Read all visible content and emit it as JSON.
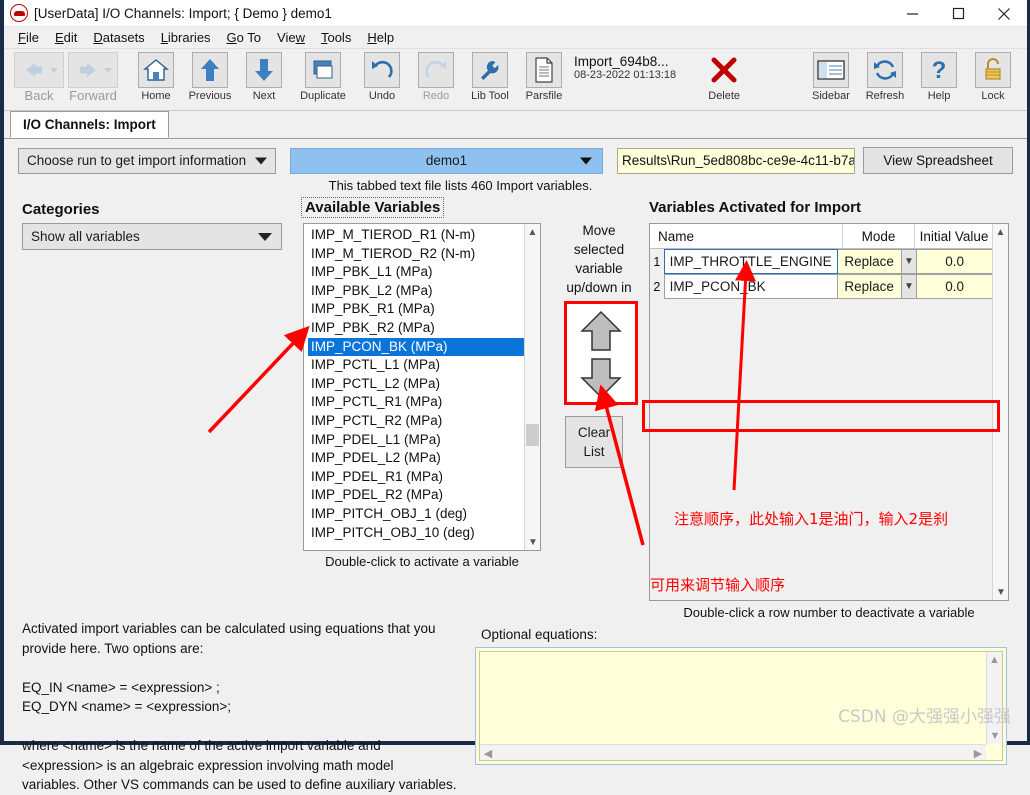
{
  "window": {
    "title": "[UserData] I/O Channels: Import; { Demo } demo1",
    "icon": "car-circle-icon",
    "controls": {
      "minimize": "—",
      "maximize": "□",
      "close": "✕"
    }
  },
  "menu": [
    {
      "label": "File",
      "accel": "F"
    },
    {
      "label": "Edit",
      "accel": "E"
    },
    {
      "label": "Datasets",
      "accel": "D"
    },
    {
      "label": "Libraries",
      "accel": "L"
    },
    {
      "label": "Go To",
      "accel": "G"
    },
    {
      "label": "View",
      "accel": "w"
    },
    {
      "label": "Tools",
      "accel": "T"
    },
    {
      "label": "Help",
      "accel": "H"
    }
  ],
  "toolbar": {
    "left": [
      {
        "label": "Back",
        "icon": "arrow-left-icon",
        "disabled": true
      },
      {
        "label": "Forward",
        "icon": "arrow-right-icon",
        "disabled": true
      },
      {
        "label": "Home",
        "icon": "home-icon",
        "disabled": false
      },
      {
        "label": "Previous",
        "icon": "arrow-up-icon",
        "disabled": false
      },
      {
        "label": "Next",
        "icon": "arrow-down-icon",
        "disabled": false
      },
      {
        "label": "Duplicate",
        "icon": "duplicate-icon",
        "disabled": false
      },
      {
        "label": "Undo",
        "icon": "undo-icon",
        "disabled": false
      },
      {
        "label": "Redo",
        "icon": "redo-icon",
        "disabled": true
      },
      {
        "label": "Lib Tool",
        "icon": "wrench-icon",
        "disabled": false
      },
      {
        "label": "Parsfile",
        "icon": "document-icon",
        "disabled": false
      }
    ],
    "parsfile": {
      "name": "Import_694b8...",
      "timestamp": "08-23-2022 01:13:18"
    },
    "delete": {
      "label": "Delete",
      "icon": "red-x-icon"
    },
    "right": [
      {
        "label": "Sidebar",
        "icon": "sidebar-icon"
      },
      {
        "label": "Refresh",
        "icon": "refresh-icon"
      },
      {
        "label": "Help",
        "icon": "question-mark-icon"
      },
      {
        "label": "Lock",
        "icon": "padlock-icon"
      }
    ]
  },
  "tab": {
    "label": "I/O Channels: Import"
  },
  "selectors": {
    "run_chooser": "Choose run to get import information",
    "dataset": "demo1",
    "path": "Results\\Run_5ed808bc-ce9e-4c11-b7a",
    "view_spreadsheet": "View Spreadsheet",
    "file_info": "This tabbed text file lists 460 Import variables."
  },
  "categories": {
    "heading": "Categories",
    "selected": "Show all variables"
  },
  "available": {
    "heading": "Available Variables",
    "hint": "Double-click to activate a variable",
    "selected_index": 6,
    "items": [
      "IMP_M_TIEROD_R1 (N-m)",
      "IMP_M_TIEROD_R2 (N-m)",
      "IMP_PBK_L1 (MPa)",
      "IMP_PBK_L2 (MPa)",
      "IMP_PBK_R1 (MPa)",
      "IMP_PBK_R2 (MPa)",
      "IMP_PCON_BK (MPa)",
      "IMP_PCTL_L1 (MPa)",
      "IMP_PCTL_L2 (MPa)",
      "IMP_PCTL_R1 (MPa)",
      "IMP_PCTL_R2 (MPa)",
      "IMP_PDEL_L1 (MPa)",
      "IMP_PDEL_L2 (MPa)",
      "IMP_PDEL_R1 (MPa)",
      "IMP_PDEL_R2 (MPa)",
      "IMP_PITCH_OBJ_1 (deg)",
      "IMP_PITCH_OBJ_10 (deg)"
    ]
  },
  "move": {
    "caption": "Move selected variable up/down in the list",
    "up_icon": "arrow-up-icon",
    "down_icon": "arrow-down-icon",
    "clear_list": "Clear\nList",
    "clear_list_line1": "Clear",
    "clear_list_line2": "List"
  },
  "activated": {
    "heading": "Variables Activated for Import",
    "columns": [
      "Name",
      "Mode",
      "Initial Value"
    ],
    "rows": [
      {
        "num": "1",
        "name": "IMP_THROTTLE_ENGINE",
        "mode": "Replace",
        "initial": "0.0"
      },
      {
        "num": "2",
        "name": "IMP_PCON_BK",
        "mode": "Replace",
        "initial": "0.0"
      }
    ],
    "hint": "Double-click a row number to deactivate a variable"
  },
  "annotations": {
    "note_order": "注意顺序，此处输入1是油门，输入2是刹",
    "note_adjust": "可用来调节输入顺序"
  },
  "help": {
    "text": "Activated import variables can be calculated using equations that you\nprovide here. Two options are:\n\nEQ_IN <name> = <expression> ;\nEQ_DYN <name> = <expression>;\n\nwhere <name> is the name of the active import variable and\n<expression> is an algebraic expression involving math model\nvariables. Other VS commands can be used to define auxiliary variables."
  },
  "equations": {
    "label": "Optional equations:",
    "value": ""
  },
  "watermark": "CSDN @大强强小强强",
  "colors": {
    "accent_blue": "#0a74d8",
    "annotation_red": "#ff0000",
    "field_yellow": "#ffffd9",
    "frame_navy": "#1b2a47"
  }
}
